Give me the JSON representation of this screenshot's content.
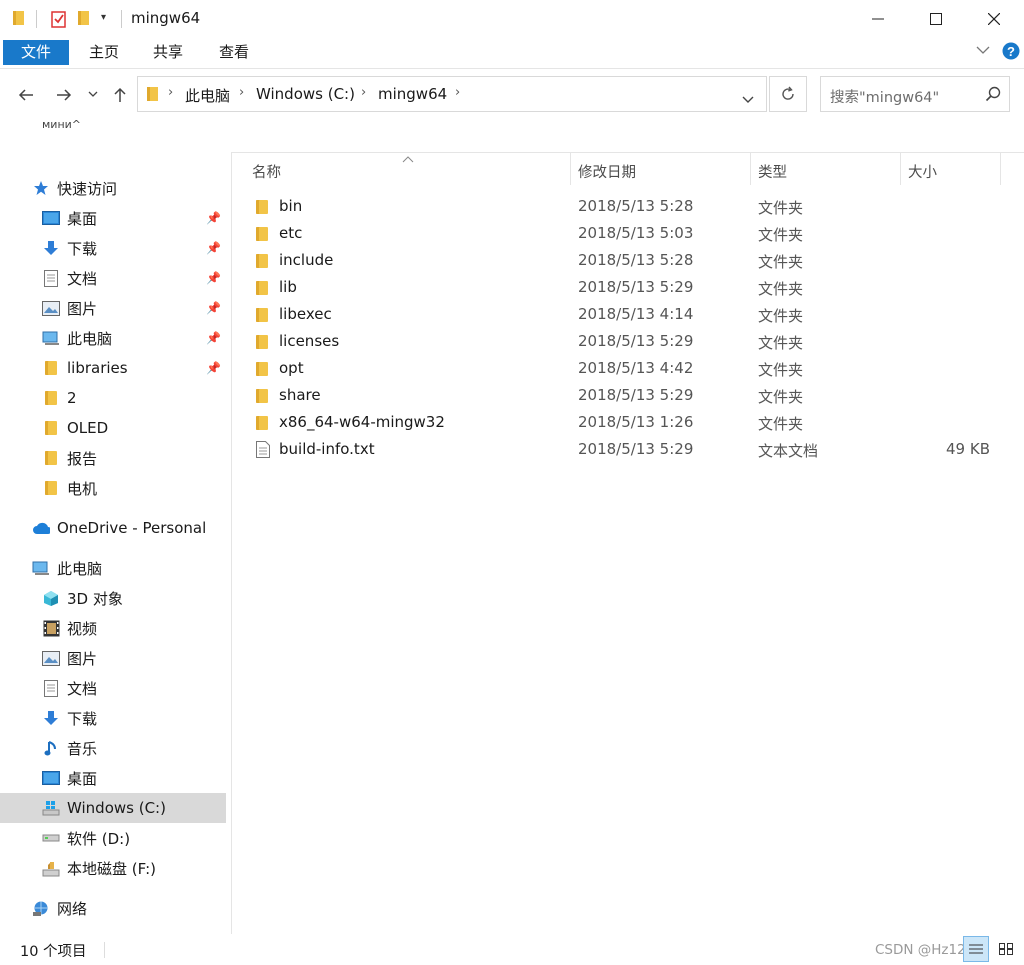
{
  "window": {
    "title": "mingw64",
    "minimize_icon": "minimize-icon",
    "maximize_icon": "maximize-icon",
    "close_icon": "close-icon"
  },
  "ribbon": {
    "tabs": [
      "文件",
      "主页",
      "共享",
      "查看"
    ],
    "accent": "#1979ca"
  },
  "address": {
    "crumbs": [
      "此电脑",
      "Windows (C:)",
      "mingw64"
    ],
    "search_placeholder": "搜索\"mingw64\""
  },
  "sidebar": {
    "clipped_label": "мини^",
    "quick_access": {
      "label": "快速访问",
      "items": [
        {
          "label": "桌面",
          "pinned": true
        },
        {
          "label": "下载",
          "pinned": true
        },
        {
          "label": "文档",
          "pinned": true
        },
        {
          "label": "图片",
          "pinned": true
        },
        {
          "label": "此电脑",
          "pinned": true
        },
        {
          "label": "libraries",
          "pinned": true
        },
        {
          "label": "2",
          "pinned": false
        },
        {
          "label": "OLED",
          "pinned": false
        },
        {
          "label": "报告",
          "pinned": false
        },
        {
          "label": "电机",
          "pinned": false
        }
      ]
    },
    "onedrive": "OneDrive - Personal",
    "this_pc": {
      "label": "此电脑",
      "items": [
        {
          "label": "3D 对象"
        },
        {
          "label": "视频"
        },
        {
          "label": "图片"
        },
        {
          "label": "文档"
        },
        {
          "label": "下载"
        },
        {
          "label": "音乐"
        },
        {
          "label": "桌面"
        },
        {
          "label": "Windows (C:)"
        },
        {
          "label": "软件 (D:)"
        },
        {
          "label": "本地磁盘 (F:)"
        }
      ]
    },
    "network": "网络"
  },
  "columns": {
    "name": "名称",
    "date": "修改日期",
    "type": "类型",
    "size": "大小"
  },
  "files": [
    {
      "name": "bin",
      "date": "2018/5/13 5:28",
      "type": "文件夹",
      "size": ""
    },
    {
      "name": "etc",
      "date": "2018/5/13 5:03",
      "type": "文件夹",
      "size": ""
    },
    {
      "name": "include",
      "date": "2018/5/13 5:28",
      "type": "文件夹",
      "size": ""
    },
    {
      "name": "lib",
      "date": "2018/5/13 5:29",
      "type": "文件夹",
      "size": ""
    },
    {
      "name": "libexec",
      "date": "2018/5/13 4:14",
      "type": "文件夹",
      "size": ""
    },
    {
      "name": "licenses",
      "date": "2018/5/13 5:29",
      "type": "文件夹",
      "size": ""
    },
    {
      "name": "opt",
      "date": "2018/5/13 4:42",
      "type": "文件夹",
      "size": ""
    },
    {
      "name": "share",
      "date": "2018/5/13 5:29",
      "type": "文件夹",
      "size": ""
    },
    {
      "name": "x86_64-w64-mingw32",
      "date": "2018/5/13 1:26",
      "type": "文件夹",
      "size": ""
    },
    {
      "name": "build-info.txt",
      "date": "2018/5/13 5:29",
      "type": "文本文档",
      "size": "49 KB"
    }
  ],
  "status": {
    "count": "10 个项目",
    "watermark": "CSDN @Hz12"
  }
}
